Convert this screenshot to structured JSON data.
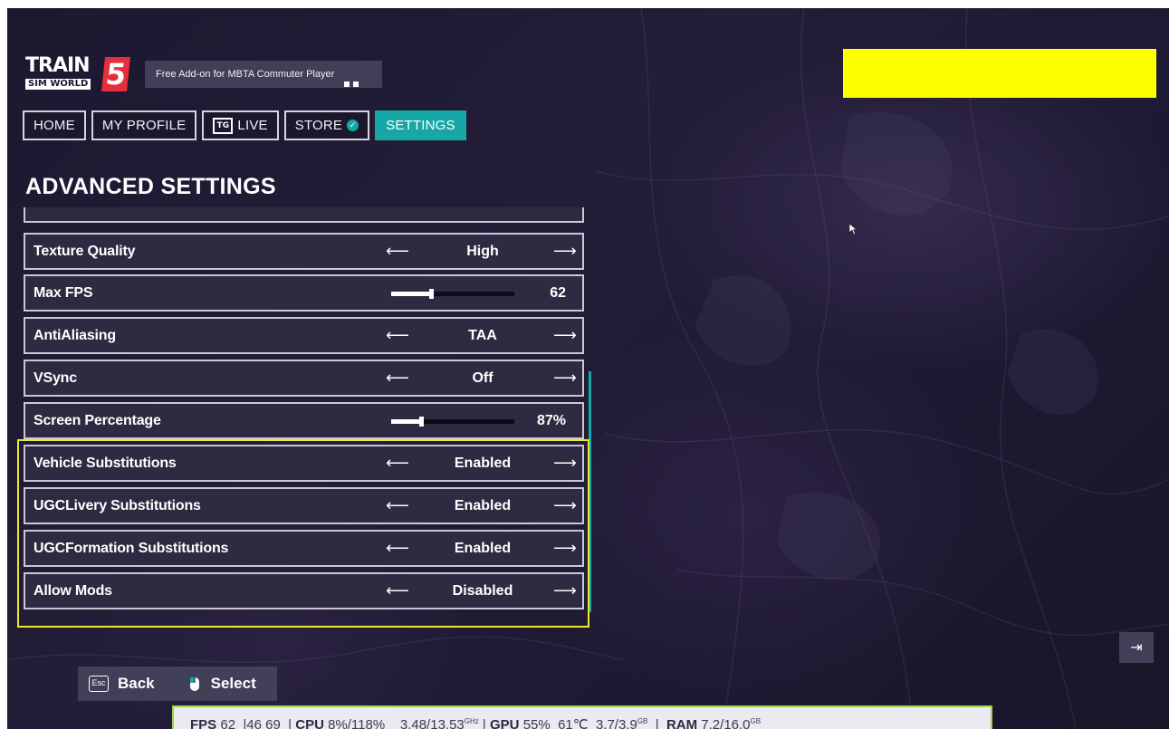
{
  "logo": {
    "title": "TRAIN",
    "subtitle": "SIM WORLD",
    "number": "5"
  },
  "addon_notice": "Free Add-on for MBTA Commuter Player",
  "colors": {
    "accent": "#17a7a6",
    "highlight": "#eaea2e",
    "redaction": "#ffff00",
    "perf_border": "#9ad44a"
  },
  "nav": {
    "home": "HOME",
    "profile": "MY PROFILE",
    "live_icon": "TG",
    "live": "LIVE",
    "store": "STORE",
    "settings": "SETTINGS"
  },
  "heading": "ADVANCED SETTINGS",
  "settings": [
    {
      "label": "Texture Quality",
      "type": "select",
      "value": "High"
    },
    {
      "label": "Max FPS",
      "type": "slider",
      "value": "62",
      "level": 0.33
    },
    {
      "label": "AntiAliasing",
      "type": "select",
      "value": "TAA"
    },
    {
      "label": "VSync",
      "type": "select",
      "value": "Off"
    },
    {
      "label": "Screen Percentage",
      "type": "slider",
      "value": "87%",
      "level": 0.25
    },
    {
      "label": "Vehicle Substitutions",
      "type": "select",
      "value": "Enabled"
    },
    {
      "label": "UGCLivery Substitutions",
      "type": "select",
      "value": "Enabled"
    },
    {
      "label": "UGCFormation Substitutions",
      "type": "select",
      "value": "Enabled"
    },
    {
      "label": "Allow Mods",
      "type": "select",
      "value": "Disabled"
    }
  ],
  "arrows": {
    "left": "⟵",
    "right": "⟶"
  },
  "help": {
    "esc_key": "Esc",
    "back": "Back",
    "select": "Select"
  },
  "exit_icon": "⇥",
  "perf": {
    "fps_label": "FPS",
    "fps_value": "62",
    "fps_range": "46 69",
    "cpu_label": "CPU",
    "cpu_value": "8%/118%",
    "cpu_ghz": "3.48/13.53",
    "ghz_unit": "GHz",
    "gpu_label": "GPU",
    "gpu_value": "55%",
    "gpu_temp": "61℃",
    "gpu_mem": "3.7/3.9",
    "gb_unit": "GB",
    "ram_label": "RAM",
    "ram_value": "7.2/16.0"
  }
}
